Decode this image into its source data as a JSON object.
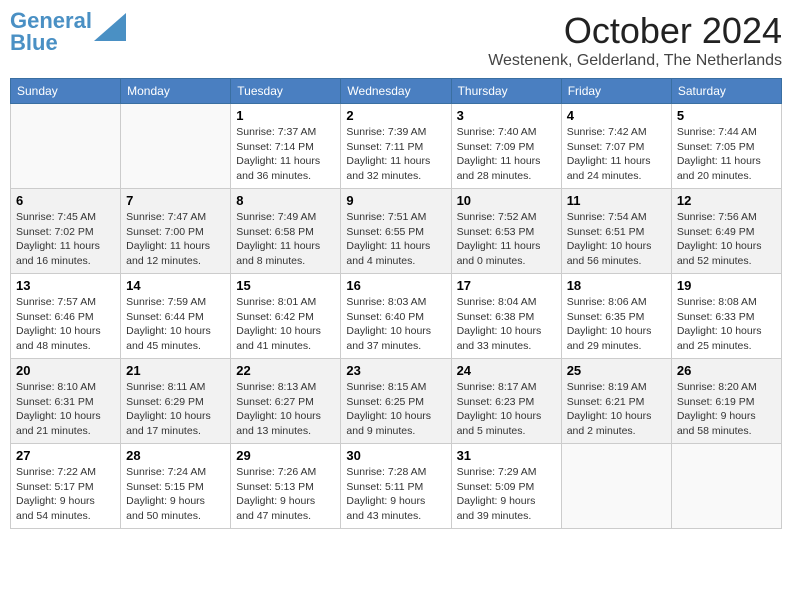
{
  "header": {
    "logo_line1": "General",
    "logo_line2": "Blue",
    "month": "October 2024",
    "location": "Westenenk, Gelderland, The Netherlands"
  },
  "days_of_week": [
    "Sunday",
    "Monday",
    "Tuesday",
    "Wednesday",
    "Thursday",
    "Friday",
    "Saturday"
  ],
  "weeks": [
    [
      {
        "day": "",
        "info": ""
      },
      {
        "day": "",
        "info": ""
      },
      {
        "day": "1",
        "info": "Sunrise: 7:37 AM\nSunset: 7:14 PM\nDaylight: 11 hours and 36 minutes."
      },
      {
        "day": "2",
        "info": "Sunrise: 7:39 AM\nSunset: 7:11 PM\nDaylight: 11 hours and 32 minutes."
      },
      {
        "day": "3",
        "info": "Sunrise: 7:40 AM\nSunset: 7:09 PM\nDaylight: 11 hours and 28 minutes."
      },
      {
        "day": "4",
        "info": "Sunrise: 7:42 AM\nSunset: 7:07 PM\nDaylight: 11 hours and 24 minutes."
      },
      {
        "day": "5",
        "info": "Sunrise: 7:44 AM\nSunset: 7:05 PM\nDaylight: 11 hours and 20 minutes."
      }
    ],
    [
      {
        "day": "6",
        "info": "Sunrise: 7:45 AM\nSunset: 7:02 PM\nDaylight: 11 hours and 16 minutes."
      },
      {
        "day": "7",
        "info": "Sunrise: 7:47 AM\nSunset: 7:00 PM\nDaylight: 11 hours and 12 minutes."
      },
      {
        "day": "8",
        "info": "Sunrise: 7:49 AM\nSunset: 6:58 PM\nDaylight: 11 hours and 8 minutes."
      },
      {
        "day": "9",
        "info": "Sunrise: 7:51 AM\nSunset: 6:55 PM\nDaylight: 11 hours and 4 minutes."
      },
      {
        "day": "10",
        "info": "Sunrise: 7:52 AM\nSunset: 6:53 PM\nDaylight: 11 hours and 0 minutes."
      },
      {
        "day": "11",
        "info": "Sunrise: 7:54 AM\nSunset: 6:51 PM\nDaylight: 10 hours and 56 minutes."
      },
      {
        "day": "12",
        "info": "Sunrise: 7:56 AM\nSunset: 6:49 PM\nDaylight: 10 hours and 52 minutes."
      }
    ],
    [
      {
        "day": "13",
        "info": "Sunrise: 7:57 AM\nSunset: 6:46 PM\nDaylight: 10 hours and 48 minutes."
      },
      {
        "day": "14",
        "info": "Sunrise: 7:59 AM\nSunset: 6:44 PM\nDaylight: 10 hours and 45 minutes."
      },
      {
        "day": "15",
        "info": "Sunrise: 8:01 AM\nSunset: 6:42 PM\nDaylight: 10 hours and 41 minutes."
      },
      {
        "day": "16",
        "info": "Sunrise: 8:03 AM\nSunset: 6:40 PM\nDaylight: 10 hours and 37 minutes."
      },
      {
        "day": "17",
        "info": "Sunrise: 8:04 AM\nSunset: 6:38 PM\nDaylight: 10 hours and 33 minutes."
      },
      {
        "day": "18",
        "info": "Sunrise: 8:06 AM\nSunset: 6:35 PM\nDaylight: 10 hours and 29 minutes."
      },
      {
        "day": "19",
        "info": "Sunrise: 8:08 AM\nSunset: 6:33 PM\nDaylight: 10 hours and 25 minutes."
      }
    ],
    [
      {
        "day": "20",
        "info": "Sunrise: 8:10 AM\nSunset: 6:31 PM\nDaylight: 10 hours and 21 minutes."
      },
      {
        "day": "21",
        "info": "Sunrise: 8:11 AM\nSunset: 6:29 PM\nDaylight: 10 hours and 17 minutes."
      },
      {
        "day": "22",
        "info": "Sunrise: 8:13 AM\nSunset: 6:27 PM\nDaylight: 10 hours and 13 minutes."
      },
      {
        "day": "23",
        "info": "Sunrise: 8:15 AM\nSunset: 6:25 PM\nDaylight: 10 hours and 9 minutes."
      },
      {
        "day": "24",
        "info": "Sunrise: 8:17 AM\nSunset: 6:23 PM\nDaylight: 10 hours and 5 minutes."
      },
      {
        "day": "25",
        "info": "Sunrise: 8:19 AM\nSunset: 6:21 PM\nDaylight: 10 hours and 2 minutes."
      },
      {
        "day": "26",
        "info": "Sunrise: 8:20 AM\nSunset: 6:19 PM\nDaylight: 9 hours and 58 minutes."
      }
    ],
    [
      {
        "day": "27",
        "info": "Sunrise: 7:22 AM\nSunset: 5:17 PM\nDaylight: 9 hours and 54 minutes."
      },
      {
        "day": "28",
        "info": "Sunrise: 7:24 AM\nSunset: 5:15 PM\nDaylight: 9 hours and 50 minutes."
      },
      {
        "day": "29",
        "info": "Sunrise: 7:26 AM\nSunset: 5:13 PM\nDaylight: 9 hours and 47 minutes."
      },
      {
        "day": "30",
        "info": "Sunrise: 7:28 AM\nSunset: 5:11 PM\nDaylight: 9 hours and 43 minutes."
      },
      {
        "day": "31",
        "info": "Sunrise: 7:29 AM\nSunset: 5:09 PM\nDaylight: 9 hours and 39 minutes."
      },
      {
        "day": "",
        "info": ""
      },
      {
        "day": "",
        "info": ""
      }
    ]
  ]
}
